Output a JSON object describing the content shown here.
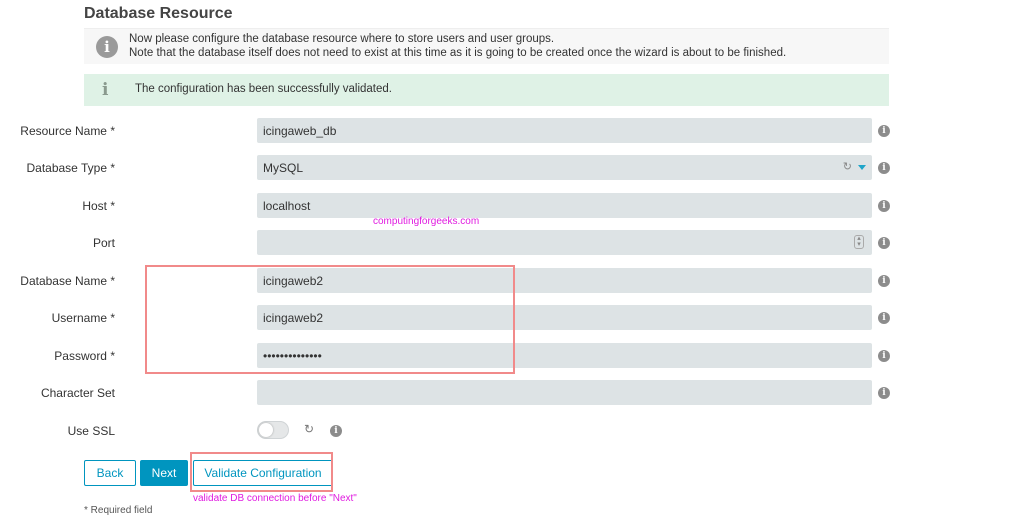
{
  "page": {
    "title": "Database Resource"
  },
  "notice": {
    "line1": "Now please configure the database resource where to store users and user groups.",
    "line2": "Note that the database itself does not need to exist at this time as it is going to be created once the wizard is about to be finished."
  },
  "success": {
    "message": "The configuration has been successfully validated."
  },
  "fields": {
    "resource_name": {
      "label": "Resource Name *",
      "value": "icingaweb_db"
    },
    "database_type": {
      "label": "Database Type *",
      "value": "MySQL"
    },
    "host": {
      "label": "Host *",
      "value": "localhost"
    },
    "port": {
      "label": "Port",
      "value": ""
    },
    "database_name": {
      "label": "Database Name *",
      "value": "icingaweb2"
    },
    "username": {
      "label": "Username *",
      "value": "icingaweb2"
    },
    "password": {
      "label": "Password *",
      "value": "••••••••••••••"
    },
    "character_set": {
      "label": "Character Set",
      "value": ""
    },
    "use_ssl": {
      "label": "Use SSL",
      "enabled": false
    }
  },
  "buttons": {
    "back": "Back",
    "next": "Next",
    "validate": "Validate Configuration"
  },
  "annotations": {
    "watermark": "computingforgeeks.com",
    "validate_note": "validate DB connection before \"Next\""
  },
  "required_note": "* Required field",
  "colors": {
    "accent": "#0095bf",
    "success_bg": "#dff2e6",
    "field_bg": "#dde3e5",
    "annotation": "#e01ae0",
    "highlight_border": "#f18a8a"
  }
}
